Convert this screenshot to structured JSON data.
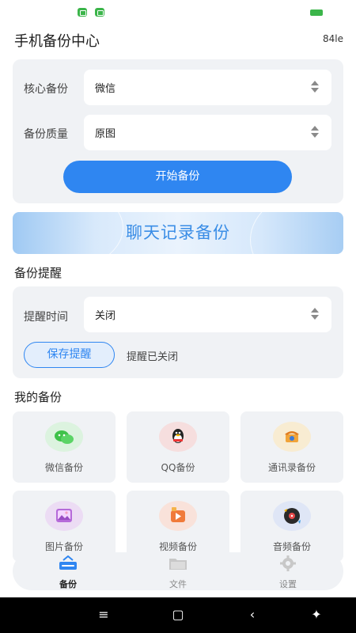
{
  "header": {
    "title": "手机备份中心",
    "right_text": "84le"
  },
  "backup_form": {
    "core_label": "核心备份",
    "core_value": "微信",
    "quality_label": "备份质量",
    "quality_value": "原图",
    "start_button": "开始备份"
  },
  "banner": {
    "text": "聊天记录备份"
  },
  "reminder": {
    "section_title": "备份提醒",
    "time_label": "提醒时间",
    "time_value": "关闭",
    "save_button": "保存提醒",
    "status": "提醒已关闭"
  },
  "my_backups": {
    "section_title": "我的备份",
    "items": [
      {
        "label": "微信备份",
        "icon": "wechat-icon"
      },
      {
        "label": "QQ备份",
        "icon": "qq-icon"
      },
      {
        "label": "通讯录备份",
        "icon": "contacts-phone-icon"
      },
      {
        "label": "图片备份",
        "icon": "image-icon"
      },
      {
        "label": "视频备份",
        "icon": "video-icon"
      },
      {
        "label": "音频备份",
        "icon": "audio-record-icon"
      }
    ]
  },
  "bottom_nav": {
    "items": [
      {
        "label": "备份",
        "icon": "backup-icon",
        "active": true
      },
      {
        "label": "文件",
        "icon": "folder-icon",
        "active": false
      },
      {
        "label": "设置",
        "icon": "gear-icon",
        "active": false
      }
    ]
  },
  "colors": {
    "accent": "#2f86f1",
    "card_bg": "#f0f2f5",
    "status_green": "#3bb54a"
  }
}
